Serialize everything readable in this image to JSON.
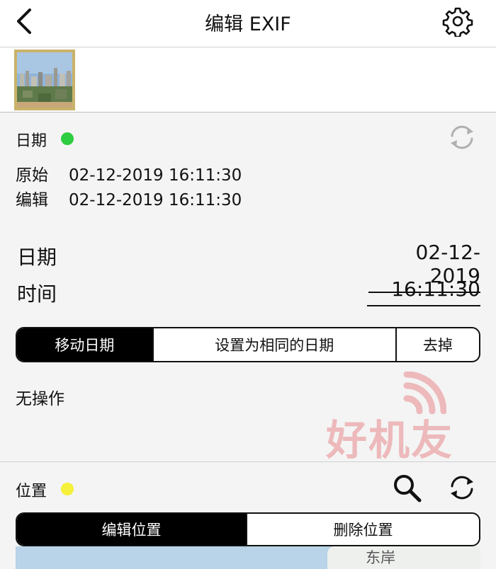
{
  "header": {
    "title": "编辑 EXIF",
    "back_icon": "chevron-left-icon",
    "settings_icon": "gear-icon"
  },
  "date_section": {
    "label": "日期",
    "status_color": "#2ecc40",
    "original_label": "原始",
    "original_value": "02-12-2019 16:11:30",
    "edited_label": "编辑",
    "edited_value": "02-12-2019 16:11:30",
    "date_label": "日期",
    "date_value": "02-12-2019",
    "time_label": "时间",
    "time_value": "16:11:30",
    "segments": [
      "移动日期",
      "设置为相同的日期",
      "去掉"
    ],
    "selected_segment": "移动日期",
    "action_text": "无操作"
  },
  "location_section": {
    "label": "位置",
    "status_color": "#f5f03a",
    "segments": [
      "编辑位置",
      "删除位置"
    ],
    "selected_segment": "编辑位置",
    "map_label": "东岸"
  },
  "watermark": {
    "text": "好机友"
  },
  "colors": {
    "accent": "#000000",
    "background": "#f4f4f4",
    "thumbnail_border": "#c9b36a"
  }
}
